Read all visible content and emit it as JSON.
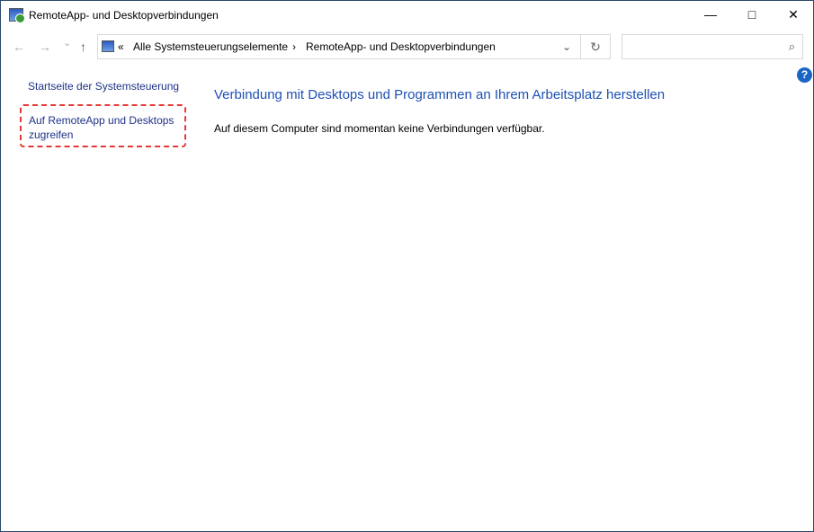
{
  "window": {
    "title": "RemoteApp- und Desktopverbindungen"
  },
  "nav": {
    "back": "←",
    "forward": "→",
    "recent": "⌄",
    "up": "↑"
  },
  "address": {
    "prefix": "«",
    "crumbs": [
      "Alle Systemsteuerungselemente",
      "RemoteApp- und Desktopverbindungen"
    ],
    "separator": "›",
    "dropdown": "⌄",
    "refresh": "↻"
  },
  "search": {
    "placeholder": "",
    "icon": "⌕"
  },
  "sidebar": {
    "home": "Startseite der Systemsteuerung",
    "access": "Auf RemoteApp und Desktops zugreifen"
  },
  "main": {
    "heading": "Verbindung mit Desktops und Programmen an Ihrem Arbeitsplatz herstellen",
    "message": "Auf diesem Computer sind momentan keine Verbindungen verfügbar."
  },
  "help": "?"
}
